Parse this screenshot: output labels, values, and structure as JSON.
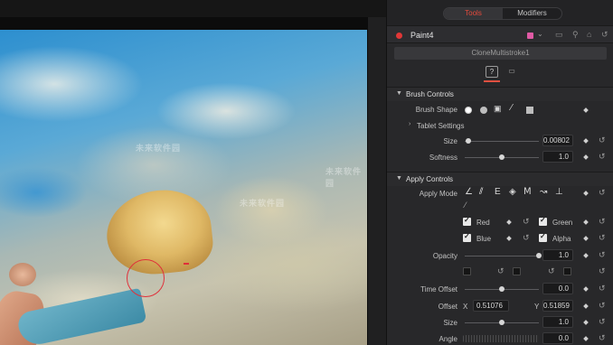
{
  "inspector": {
    "tabs": [
      {
        "label": "Tools",
        "active": true
      },
      {
        "label": "Modifiers",
        "active": false
      }
    ],
    "node": {
      "name": "Paint4",
      "color": "#e05aa5",
      "subtitle": "CloneMultistroke1"
    },
    "subtabs": [
      {
        "icon": "question-icon",
        "glyph": "?"
      },
      {
        "icon": "settings-panel-icon",
        "glyph": "▭"
      }
    ],
    "brush_controls": {
      "title": "Brush Controls",
      "brush_shape_label": "Brush Shape",
      "brush_shapes": [
        "soft-circle-icon",
        "hard-circle-icon",
        "image-brush-icon",
        "single-pixel-icon",
        "square-brush-icon"
      ],
      "tablet_settings_label": "Tablet Settings",
      "size_label": "Size",
      "size_value": "0.00802",
      "size_level": 0.05,
      "softness_label": "Softness",
      "softness_value": "1.0",
      "softness_level": 0.5
    },
    "apply_controls": {
      "title": "Apply Controls",
      "apply_mode_label": "Apply Mode",
      "apply_modes": [
        "color-mode-icon",
        "clone-mode-icon",
        "emboss-mode-icon",
        "erase-mode-icon",
        "merge-mode-icon",
        "smear-mode-icon",
        "stamp-mode-icon",
        "wire-mode-icon"
      ],
      "channels": [
        {
          "label": "Red",
          "checked": true
        },
        {
          "label": "Green",
          "checked": true
        },
        {
          "label": "Blue",
          "checked": true
        },
        {
          "label": "Alpha",
          "checked": true
        }
      ],
      "opacity_label": "Opacity",
      "opacity_value": "1.0",
      "opacity_level": 1.0,
      "time_offset_label": "Time Offset",
      "time_offset_value": "0.0",
      "time_offset_level": 0.5,
      "offset_label": "Offset",
      "offset_x_label": "X",
      "offset_x_value": "0.51076",
      "offset_y_label": "Y",
      "offset_y_value": "0.51859",
      "size_label": "Size",
      "size_value": "1.0",
      "size_level": 0.5,
      "angle_label": "Angle",
      "angle_value": "0.0"
    }
  },
  "viewer": {
    "watermark": "未来软件园"
  }
}
